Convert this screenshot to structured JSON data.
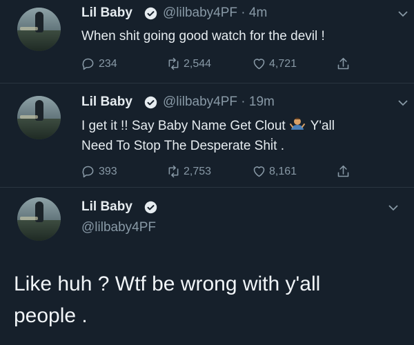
{
  "colors": {
    "background": "#16202b",
    "text": "#e6ecf0",
    "muted": "#8899a6",
    "divider": "#2a3641",
    "verified": "#e6ecf0"
  },
  "tweets": [
    {
      "name": "Lil Baby",
      "handle": "@lilbaby4PF · 4m",
      "text_line1": "When shit going good watch for the devil !",
      "replies": "234",
      "retweets": "2,544",
      "likes": "4,721"
    },
    {
      "name": "Lil Baby",
      "handle": "@lilbaby4PF · 19m",
      "text_line1_a": "I get it !! Say Baby Name Get Clout",
      "emoji": "shrug-emoji",
      "text_line1_b": "Y'all",
      "text_line2": "Need To Stop The Desperate Shi̇t .",
      "replies": "393",
      "retweets": "2,753",
      "likes": "8,161"
    },
    {
      "name": "Lil Baby",
      "handle": "@lilbaby4PF",
      "text_line1": "Like huh ? Wtf be wrong with y'all",
      "text_line2": "people ."
    }
  ],
  "icons": {
    "reply": "reply-icon",
    "retweet": "retweet-icon",
    "like": "heart-icon",
    "share": "share-icon",
    "verified": "verified-badge-icon",
    "menu": "chevron-down-icon"
  }
}
